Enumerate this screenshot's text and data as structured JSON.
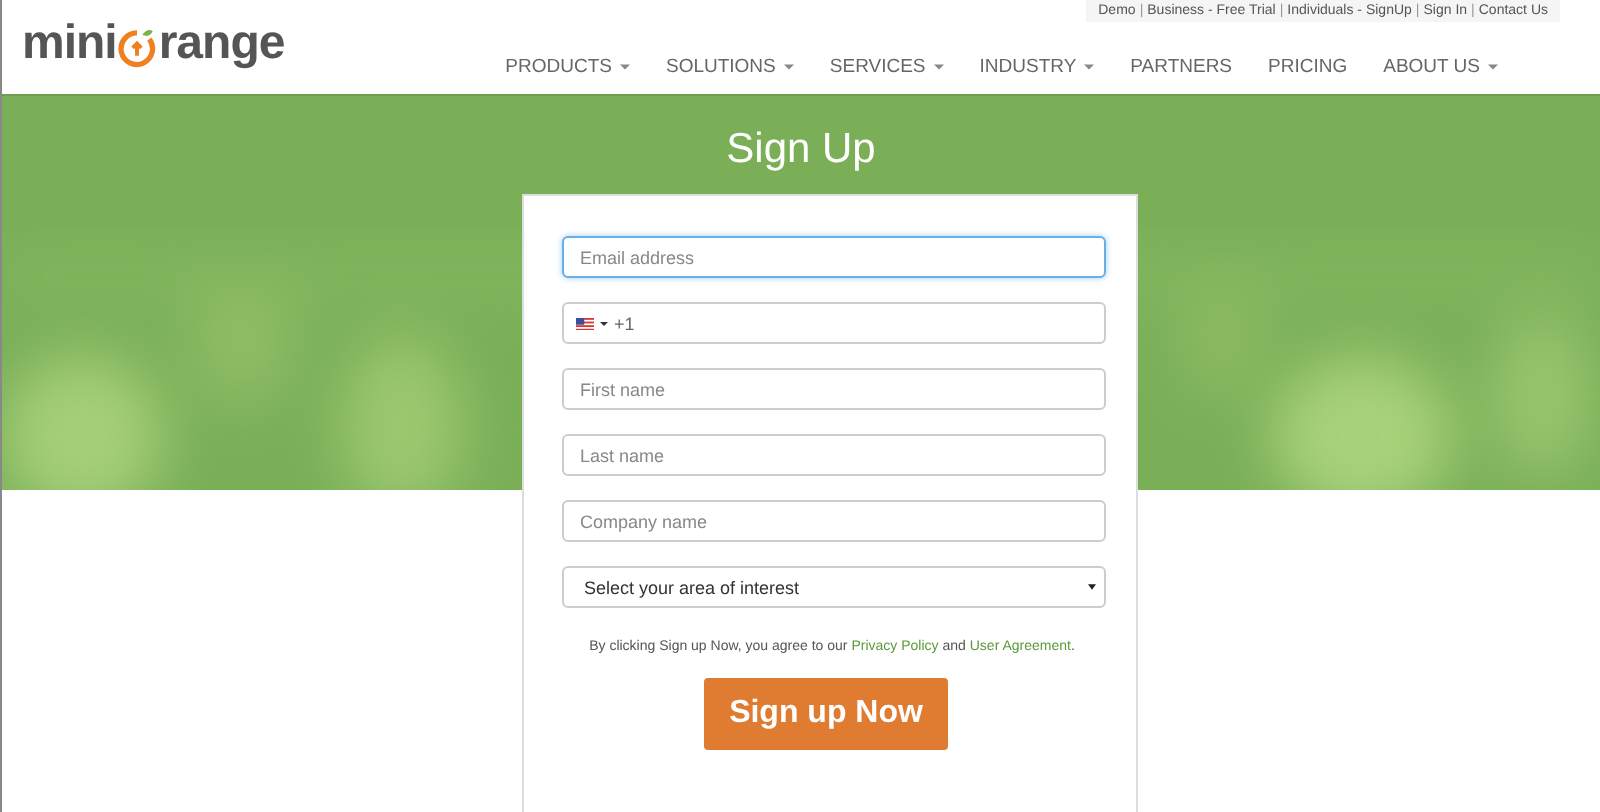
{
  "logo": {
    "before": "mini",
    "after": "range"
  },
  "top_links": {
    "separator": "|",
    "items": [
      "Demo",
      "Business - Free Trial",
      "Individuals - SignUp",
      "Sign In",
      "Contact Us"
    ]
  },
  "nav": [
    {
      "label": "PRODUCTS",
      "dropdown": true
    },
    {
      "label": "SOLUTIONS",
      "dropdown": true
    },
    {
      "label": "SERVICES",
      "dropdown": true
    },
    {
      "label": "INDUSTRY",
      "dropdown": true
    },
    {
      "label": "PARTNERS",
      "dropdown": false
    },
    {
      "label": "PRICING",
      "dropdown": false
    },
    {
      "label": "ABOUT US",
      "dropdown": true
    }
  ],
  "hero": {
    "title": "Sign Up"
  },
  "form": {
    "fields": [
      {
        "kind": "input",
        "placeholder": "Email address",
        "focused": true
      },
      {
        "kind": "phone",
        "value": "+1",
        "focused": false
      },
      {
        "kind": "input",
        "placeholder": "First name",
        "focused": false
      },
      {
        "kind": "input",
        "placeholder": "Last name",
        "focused": false
      },
      {
        "kind": "input",
        "placeholder": "Company name",
        "focused": false
      },
      {
        "kind": "select",
        "value": "Select your area of interest",
        "focused": false
      }
    ],
    "consent": [
      {
        "kind": "text",
        "text": "By clicking Sign up Now, you agree to our "
      },
      {
        "kind": "link",
        "text": "Privacy Policy"
      },
      {
        "kind": "text",
        "text": " and "
      },
      {
        "kind": "link",
        "text": "User Agreement"
      },
      {
        "kind": "text",
        "text": "."
      }
    ],
    "submit": "Sign up Now"
  }
}
